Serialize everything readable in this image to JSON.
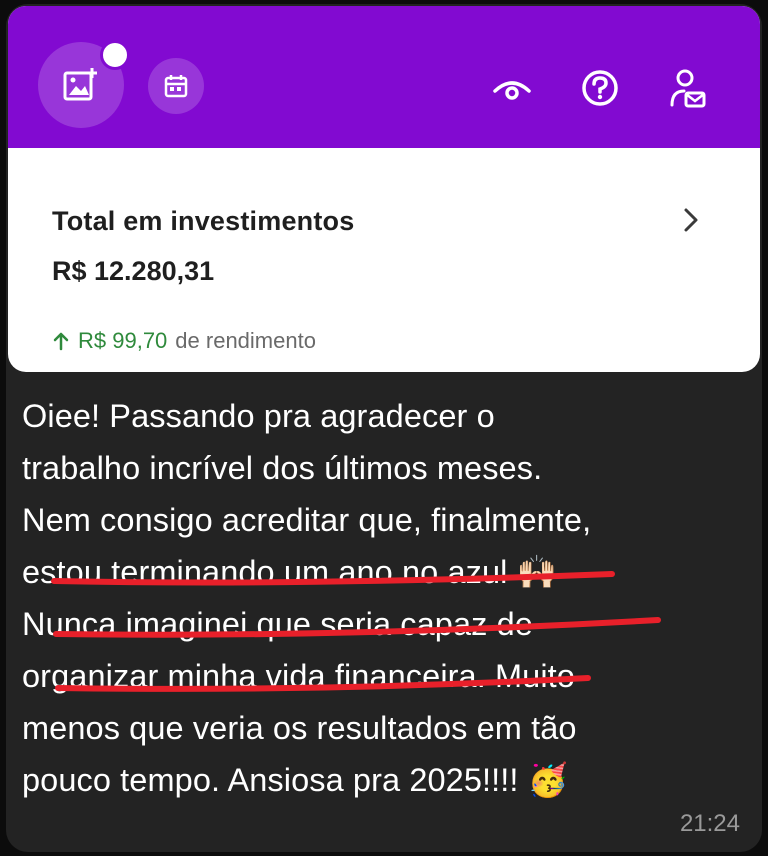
{
  "app_card": {
    "accent_color": "#820ad1",
    "header_icons": [
      "add-image-icon",
      "calendar-icon",
      "eye-icon",
      "help-icon",
      "user-mail-icon"
    ],
    "title": "Total em investimentos",
    "value": "R$ 12.280,31",
    "yield_arrow": "↑",
    "yield_amount": "R$ 99,70",
    "yield_label": "de rendimento",
    "positive_color": "#2f8a3c"
  },
  "message": {
    "lines": [
      "Oiee! Passando pra agradecer o",
      "trabalho incrível dos últimos meses.",
      "Nem consigo acreditar que, finalmente,",
      "estou terminando um ano no azul",
      "Nunca imaginei que seria capaz de",
      "organizar minha vida financeira. Muito",
      "menos que veria os resultados em tão",
      "pouco tempo. Ansiosa pra 2025!!!!"
    ],
    "emoji_1": "🙌🏻",
    "emoji_2": "🥳",
    "underline_color": "#e8202a",
    "time": "21:24"
  }
}
